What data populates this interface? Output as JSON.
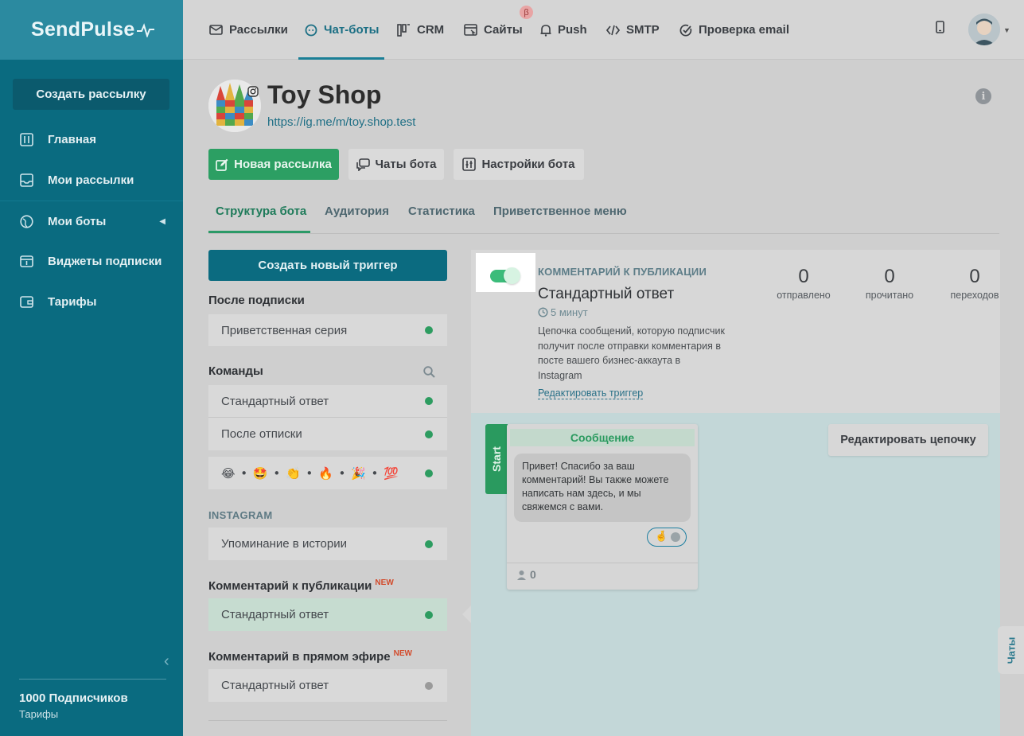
{
  "app": {
    "brand": "SendPulse",
    "create_campaign": "Создать рассылку"
  },
  "sidebar": {
    "items": [
      {
        "label": "Главная",
        "icon": "sliders-icon"
      },
      {
        "label": "Мои рассылки",
        "icon": "inbox-icon"
      },
      {
        "label": "Мои боты",
        "icon": "globe-icon"
      },
      {
        "label": "Виджеты подписки",
        "icon": "widget-icon"
      },
      {
        "label": "Тарифы",
        "icon": "wallet-icon"
      }
    ],
    "subscribers": "1000 Подписчиков",
    "tariffs": "Тарифы"
  },
  "topnav": {
    "items": [
      {
        "label": "Рассылки",
        "icon": "mail-icon"
      },
      {
        "label": "Чат-боты",
        "icon": "chatbot-icon"
      },
      {
        "label": "CRM",
        "icon": "crm-icon"
      },
      {
        "label": "Сайты",
        "icon": "site-icon"
      },
      {
        "label": "Push",
        "icon": "bell-icon"
      },
      {
        "label": "SMTP",
        "icon": "code-icon"
      },
      {
        "label": "Проверка email",
        "icon": "check-circle-icon"
      }
    ],
    "active": "Чат-боты",
    "beta_badge": "β"
  },
  "bot": {
    "name": "Toy Shop",
    "link": "https://ig.me/m/toy.shop.test"
  },
  "actions": {
    "new_campaign": "Новая рассылка",
    "bot_chats": "Чаты бота",
    "bot_settings": "Настройки бота"
  },
  "tabs": {
    "items": [
      "Структура бота",
      "Аудитория",
      "Статистика",
      "Приветственное меню"
    ],
    "active": "Структура бота"
  },
  "triggers": {
    "create_button": "Создать новый триггер",
    "after_subscribe": {
      "title": "После подписки",
      "items": [
        {
          "label": "Приветственная серия",
          "status": "active"
        }
      ]
    },
    "commands": {
      "title": "Команды",
      "items": [
        {
          "label": "Стандартный ответ",
          "status": "active"
        },
        {
          "label": "После отписки",
          "status": "active"
        },
        {
          "label": "😂 • 🤩 • 👏 • 🔥 • 🎉 • 💯",
          "status": "active"
        }
      ]
    },
    "instagram": {
      "title": "INSTAGRAM",
      "items": [
        {
          "label": "Упоминание в истории",
          "status": "active"
        }
      ]
    },
    "post_comment": {
      "title": "Комментарий к публикации",
      "new_badge": "NEW",
      "items": [
        {
          "label": "Стандартный ответ",
          "status": "active",
          "selected": true
        }
      ]
    },
    "live_comment": {
      "title": "Комментарий в прямом эфире",
      "new_badge": "NEW",
      "items": [
        {
          "label": "Стандартный ответ",
          "status": "inactive"
        }
      ]
    }
  },
  "detail": {
    "enabled": true,
    "category": "КОММЕНТАРИЙ К ПУБЛИКАЦИИ",
    "title": "Стандартный ответ",
    "delay": "5 минут",
    "description": "Цепочка сообщений, которую подписчик получит после отправки комментария в посте вашего бизнес-аккаута в Instagram",
    "edit_trigger": "Редактировать триггер",
    "stats": [
      {
        "value": "0",
        "label": "отправлено"
      },
      {
        "value": "0",
        "label": "прочитано"
      },
      {
        "value": "0",
        "label": "переходов"
      }
    ]
  },
  "flow": {
    "start_label": "Start",
    "message_title": "Сообщение",
    "message_text": "Привет! Спасибо за ваш комментарий! Вы также можете написать нам здесь, и мы свяжемся с вами.",
    "reaction_emoji": "🤞",
    "recipients": "0",
    "edit_chain": "Редактировать цепочку"
  },
  "chats_tab": "Чаты"
}
